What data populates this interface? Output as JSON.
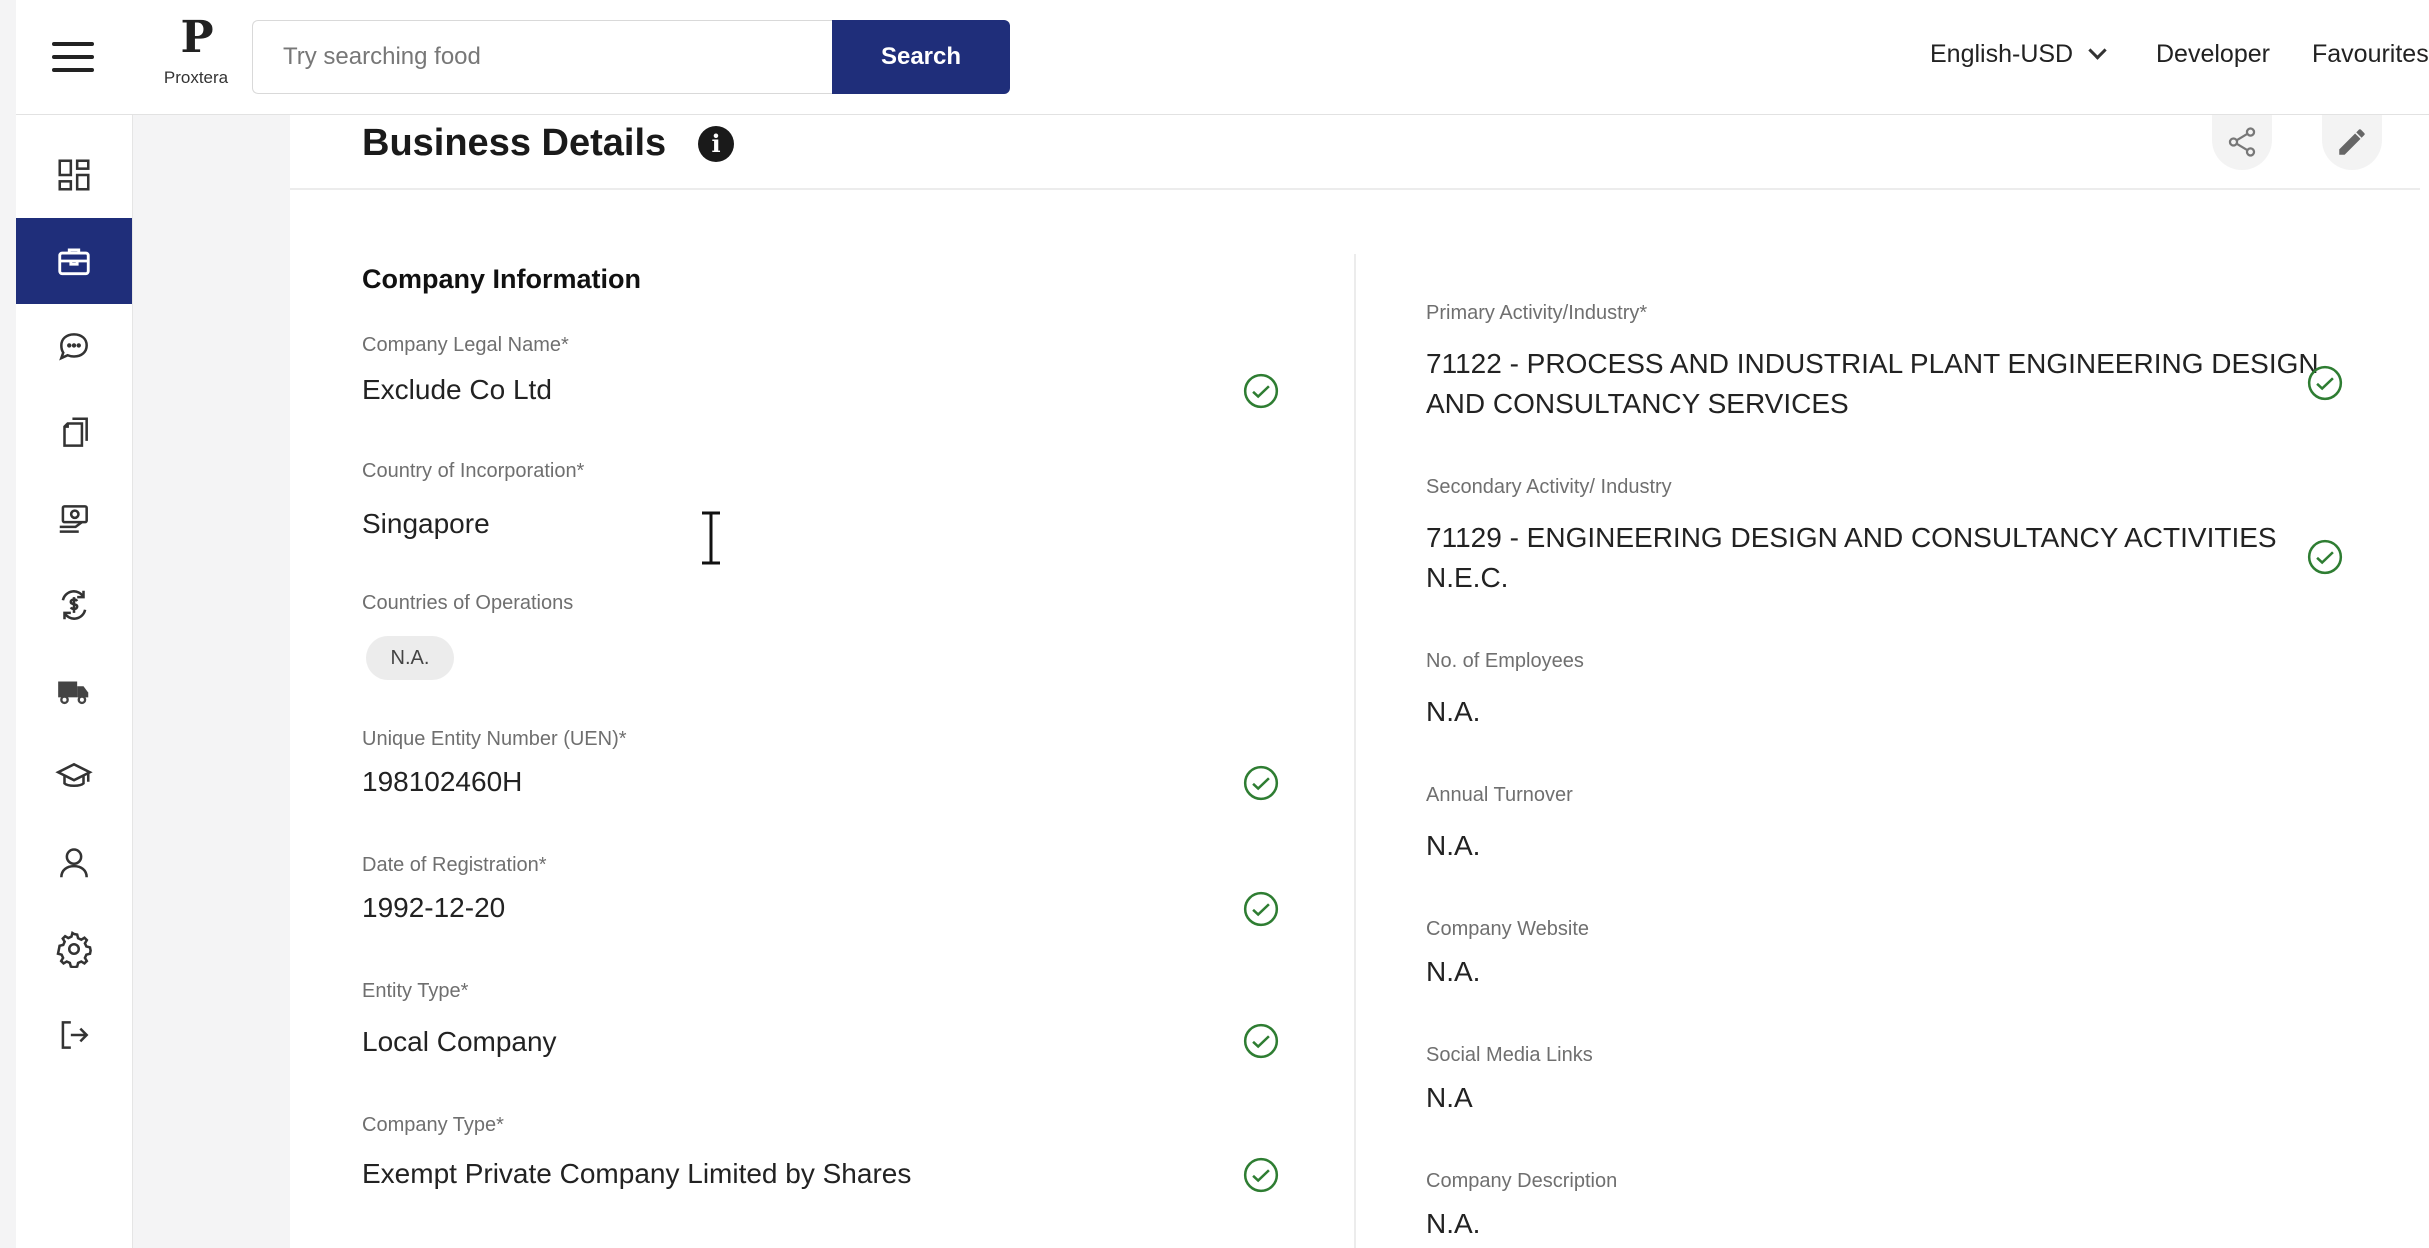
{
  "header": {
    "logo_text": "Proxtera",
    "search_placeholder": "Try searching food",
    "search_button": "Search",
    "language": "English-USD",
    "nav_developer": "Developer",
    "nav_favourites": "Favourites"
  },
  "sidebar": {
    "items": [
      {
        "icon": "dashboard-icon"
      },
      {
        "icon": "briefcase-icon",
        "active": true
      },
      {
        "icon": "chat-icon"
      },
      {
        "icon": "documents-icon"
      },
      {
        "icon": "payments-icon"
      },
      {
        "icon": "exchange-icon"
      },
      {
        "icon": "truck-icon"
      },
      {
        "icon": "graduation-cap-icon"
      },
      {
        "icon": "user-icon"
      },
      {
        "icon": "settings-icon"
      },
      {
        "icon": "logout-icon"
      }
    ]
  },
  "page": {
    "title": "Business Details",
    "section_title": "Company Information"
  },
  "left_fields": {
    "legal_name": {
      "label": "Company Legal Name*",
      "value": "Exclude Co Ltd",
      "verified": true
    },
    "country_incorp": {
      "label": "Country of Incorporation*",
      "value": "Singapore"
    },
    "countries_ops": {
      "label": "Countries of Operations",
      "value": "N.A."
    },
    "uen": {
      "label": "Unique Entity Number (UEN)*",
      "value": "198102460H",
      "verified": true
    },
    "reg_date": {
      "label": "Date of Registration*",
      "value": "1992-12-20",
      "verified": true
    },
    "entity_type": {
      "label": "Entity Type*",
      "value": "Local Company",
      "verified": true
    },
    "company_type": {
      "label": "Company Type*",
      "value": "Exempt Private Company Limited by Shares",
      "verified": true
    }
  },
  "right_fields": {
    "primary_activity": {
      "label": "Primary Activity/Industry*",
      "line1": "71122 - PROCESS AND INDUSTRIAL PLANT ENGINEERING DESIGN",
      "line2": "AND CONSULTANCY SERVICES",
      "verified": true
    },
    "secondary_activity": {
      "label": "Secondary Activity/ Industry",
      "line1": "71129 - ENGINEERING DESIGN AND CONSULTANCY ACTIVITIES",
      "line2": "N.E.C.",
      "verified": true
    },
    "employees": {
      "label": "No. of Employees",
      "value": "N.A."
    },
    "turnover": {
      "label": "Annual Turnover",
      "value": "N.A."
    },
    "website": {
      "label": "Company Website",
      "value": "N.A."
    },
    "social": {
      "label": "Social Media Links",
      "value": "N.A"
    },
    "description": {
      "label": "Company Description",
      "value": "N.A."
    }
  },
  "colors": {
    "brand": "#1f2e7a",
    "verified": "#2e7d32"
  }
}
